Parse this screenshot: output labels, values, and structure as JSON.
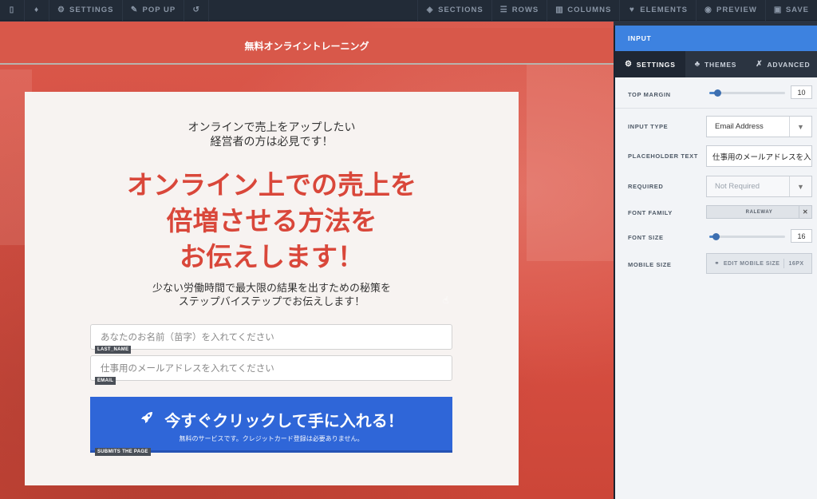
{
  "toolbar": {
    "left": [
      {
        "icon": "mobile-icon",
        "label": ""
      },
      {
        "icon": "flame-icon",
        "label": ""
      },
      {
        "icon": "gear-icon",
        "label": "SETTINGS"
      },
      {
        "icon": "edit-icon",
        "label": "POP UP"
      },
      {
        "icon": "undo-icon",
        "label": ""
      }
    ],
    "right": [
      {
        "icon": "sections-icon",
        "label": "SECTIONS"
      },
      {
        "icon": "rows-icon",
        "label": "ROWS"
      },
      {
        "icon": "columns-icon",
        "label": "COLUMNS"
      },
      {
        "icon": "elements-icon",
        "label": "ELEMENTS"
      },
      {
        "icon": "eye-icon",
        "label": "PREVIEW"
      },
      {
        "icon": "save-icon",
        "label": "SAVE"
      }
    ]
  },
  "page": {
    "header_title": "無料オンライントレーニング",
    "sub1_line1": "オンラインで売上をアップしたい",
    "sub1_line2": "経営者の方は必見です！",
    "headline_line1": "オンライン上での売上を",
    "headline_line2": "倍増させる方法を",
    "headline_line3": "お伝えします！",
    "sub2_line1": "少ない労働時間で最大限の結果を出すための秘策を",
    "sub2_line2": "ステップバイステップでお伝えします！",
    "name_placeholder": "あなたのお名前（苗字）を入れてください",
    "name_tag": "LAST_NAME",
    "email_placeholder": "仕事用のメールアドレスを入れてください",
    "email_tag": "EMAIL",
    "cta_label": "今すぐクリックして手に入れる！",
    "cta_sub": "無料のサービスです。クレジットカード登録は必要ありません。",
    "cta_tag": "SUBMITS THE PAGE"
  },
  "panel": {
    "title": "INPUT",
    "tabs": [
      {
        "icon": "gear-icon",
        "label": "SETTINGS",
        "active": true
      },
      {
        "icon": "themes-icon",
        "label": "THEMES",
        "active": false
      },
      {
        "icon": "wrench-icon",
        "label": "ADVANCED",
        "active": false
      }
    ],
    "top_margin_label": "TOP MARGIN",
    "top_margin_value": "10",
    "top_margin_level": 0.1,
    "input_type_label": "INPUT TYPE",
    "input_type_value": "Email Address",
    "placeholder_label": "PLACEHOLDER TEXT",
    "placeholder_value": "仕事用のメールアドレスを入",
    "required_label": "REQUIRED",
    "required_value": "Not Required",
    "font_family_label": "FONT FAMILY",
    "font_family_value": "RALEWAY",
    "font_size_label": "FONT SIZE",
    "font_size_value": "16",
    "font_size_level": 0.08,
    "mobile_size_label": "MOBILE SIZE",
    "mobile_size_button": "EDIT MOBILE SIZE",
    "mobile_size_value": "16PX"
  },
  "colors": {
    "accent": "#3d82e0",
    "headline": "#d9473a",
    "cta": "#2f66d8",
    "canvas_bg": "#d8584a"
  }
}
